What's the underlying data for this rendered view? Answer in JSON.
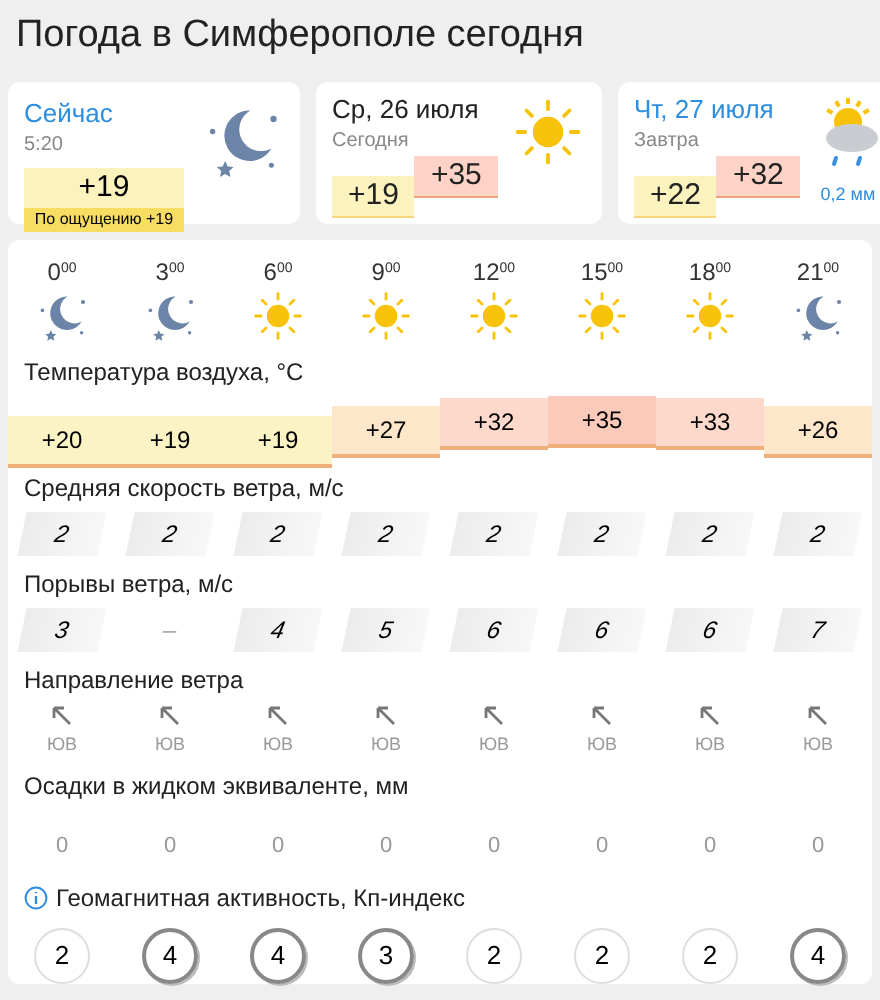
{
  "title": "Погода в Симферополе сегодня",
  "now": {
    "label": "Сейчас",
    "time": "5:20",
    "temp": "+19",
    "feels": "По ощущению +19",
    "kind": "night"
  },
  "days": [
    {
      "date": "Ср, 26 июля",
      "sub": "Сегодня",
      "kind": "sun",
      "min": "+19",
      "max": "+35",
      "selected": false
    },
    {
      "date": "Чт, 27 июля",
      "sub": "Завтра",
      "kind": "rain",
      "min": "+22",
      "max": "+32",
      "precip": "0,2 мм",
      "selected": true
    }
  ],
  "hours": [
    {
      "h": "0",
      "m": "00",
      "kind": "night"
    },
    {
      "h": "3",
      "m": "00",
      "kind": "night"
    },
    {
      "h": "6",
      "m": "00",
      "kind": "sun"
    },
    {
      "h": "9",
      "m": "00",
      "kind": "sun"
    },
    {
      "h": "12",
      "m": "00",
      "kind": "sun"
    },
    {
      "h": "15",
      "m": "00",
      "kind": "sun"
    },
    {
      "h": "18",
      "m": "00",
      "kind": "sun"
    },
    {
      "h": "21",
      "m": "00",
      "kind": "night"
    }
  ],
  "temp_label": "Температура воздуха, °C",
  "temps": [
    {
      "value": "+20",
      "kind": "cool",
      "color": "#fbf3c4"
    },
    {
      "value": "+19",
      "kind": "cool",
      "color": "#fbf3c4"
    },
    {
      "value": "+19",
      "kind": "cool",
      "color": "#fbf3c4"
    },
    {
      "value": "+27",
      "kind": "warm",
      "color": "#fde6c9"
    },
    {
      "value": "+32",
      "kind": "hot",
      "color": "#fcd9cb"
    },
    {
      "value": "+35",
      "kind": "peak",
      "color": "#fccabb"
    },
    {
      "value": "+33",
      "kind": "hot",
      "color": "#fcd9cb"
    },
    {
      "value": "+26",
      "kind": "warm",
      "color": "#fde6c9"
    }
  ],
  "wind_label": "Средняя скорость ветра, м/с",
  "wind": [
    "2",
    "2",
    "2",
    "2",
    "2",
    "2",
    "2",
    "2"
  ],
  "gust_label": "Порывы ветра, м/с",
  "gusts": [
    {
      "value": "3",
      "empty": false
    },
    {
      "value": "–",
      "empty": true
    },
    {
      "value": "4",
      "empty": false
    },
    {
      "value": "5",
      "empty": false
    },
    {
      "value": "6",
      "empty": false
    },
    {
      "value": "6",
      "empty": false
    },
    {
      "value": "6",
      "empty": false
    },
    {
      "value": "7",
      "empty": false
    }
  ],
  "dir_label": "Направление ветра",
  "dirs": [
    "ЮВ",
    "ЮВ",
    "ЮВ",
    "ЮВ",
    "ЮВ",
    "ЮВ",
    "ЮВ",
    "ЮВ"
  ],
  "precip_label": "Осадки в жидком эквиваленте, мм",
  "precip": [
    "0",
    "0",
    "0",
    "0",
    "0",
    "0",
    "0",
    "0"
  ],
  "geo_label": "Геомагнитная активность, Кп-индекс",
  "geo": [
    {
      "value": "2",
      "elevated": false
    },
    {
      "value": "4",
      "elevated": true
    },
    {
      "value": "4",
      "elevated": true
    },
    {
      "value": "3",
      "elevated": true
    },
    {
      "value": "2",
      "elevated": false
    },
    {
      "value": "2",
      "elevated": false
    },
    {
      "value": "2",
      "elevated": false
    },
    {
      "value": "4",
      "elevated": true
    }
  ]
}
